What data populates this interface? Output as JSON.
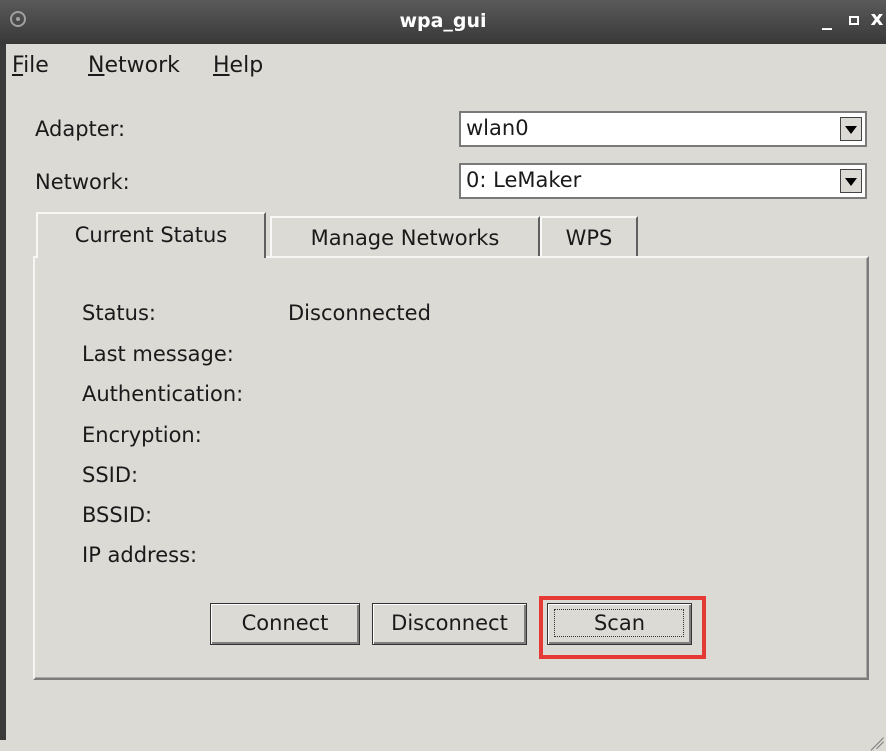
{
  "window": {
    "title": "wpa_gui",
    "min_symbol": "_",
    "close_symbol": "x"
  },
  "menu": {
    "file_ul": "F",
    "file_rest": "ile",
    "network_ul": "N",
    "network_rest": "etwork",
    "help_ul": "H",
    "help_rest": "elp"
  },
  "adapter": {
    "label": "Adapter:",
    "value": "wlan0"
  },
  "network": {
    "label": "Network:",
    "value": "0: LeMaker"
  },
  "tabs": [
    {
      "label": "Current Status"
    },
    {
      "label": "Manage Networks"
    },
    {
      "label": "WPS"
    }
  ],
  "status": {
    "status_label": "Status:",
    "status_value": "Disconnected",
    "last_message_label": "Last message:",
    "authentication_label": "Authentication:",
    "encryption_label": "Encryption:",
    "ssid_label": "SSID:",
    "bssid_label": "BSSID:",
    "ip_label": "IP address:"
  },
  "buttons": {
    "connect": "Connect",
    "disconnect": "Disconnect",
    "scan": "Scan"
  },
  "colors": {
    "background": "#dcdad5",
    "titlebar": "#3f3f3f",
    "highlight": "#e53935"
  }
}
